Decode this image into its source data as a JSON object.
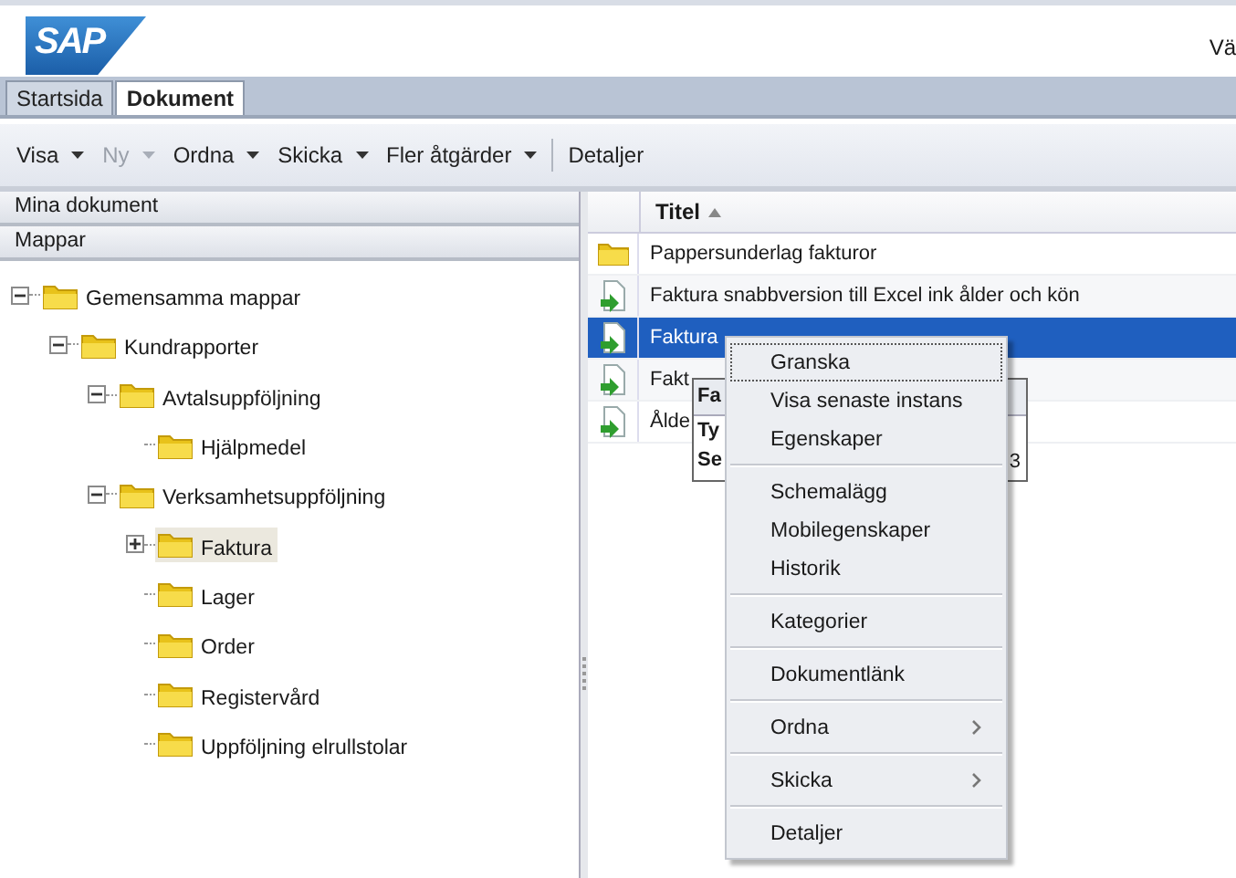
{
  "header": {
    "logo": "SAP",
    "user_text": "Vä"
  },
  "tabs": [
    {
      "label": "Startsida",
      "selected": false
    },
    {
      "label": "Dokument",
      "selected": true
    }
  ],
  "toolbar": [
    {
      "label": "Visa",
      "kind": "dropdown",
      "disabled": false
    },
    {
      "label": "Ny",
      "kind": "dropdown",
      "disabled": true
    },
    {
      "label": "Ordna",
      "kind": "dropdown",
      "disabled": false
    },
    {
      "label": "Skicka",
      "kind": "dropdown",
      "disabled": false
    },
    {
      "label": "Fler åtgärder",
      "kind": "dropdown",
      "disabled": false
    },
    {
      "label": "Detaljer",
      "kind": "button",
      "disabled": false
    }
  ],
  "sidebar": {
    "sections": [
      "Mina dokument",
      "Mappar"
    ],
    "tree": [
      {
        "label": "Gemensamma mappar",
        "kind": "branch",
        "expanded": true,
        "selected": false,
        "children": [
          {
            "label": "Kundrapporter",
            "kind": "branch",
            "expanded": true,
            "selected": false,
            "children": [
              {
                "label": "Avtalsuppföljning",
                "kind": "branch",
                "expanded": true,
                "selected": false,
                "children": [
                  {
                    "label": "Hjälpmedel",
                    "kind": "leaf",
                    "selected": false
                  }
                ]
              },
              {
                "label": "Verksamhetsuppföljning",
                "kind": "branch",
                "expanded": true,
                "selected": false,
                "children": [
                  {
                    "label": "Faktura",
                    "kind": "branch",
                    "expanded": false,
                    "selected": true
                  },
                  {
                    "label": "Lager",
                    "kind": "leaf",
                    "selected": false
                  },
                  {
                    "label": "Order",
                    "kind": "leaf",
                    "selected": false
                  },
                  {
                    "label": "Registervård",
                    "kind": "leaf",
                    "selected": false
                  },
                  {
                    "label": "Uppföljning elrullstolar",
                    "kind": "leaf",
                    "selected": false
                  }
                ]
              }
            ]
          }
        ]
      }
    ]
  },
  "table": {
    "columns": [
      {
        "label": "Titel"
      }
    ],
    "rows": [
      {
        "title": "Pappersunderlag fakturor",
        "kind": "folder",
        "selected": false
      },
      {
        "title": "Faktura snabbversion till Excel ink ålder och kön",
        "kind": "report",
        "selected": false
      },
      {
        "title": "Faktura",
        "kind": "report",
        "selected": true
      },
      {
        "title": "Fakt",
        "kind": "report",
        "selected": false
      },
      {
        "title": "Ålde",
        "kind": "report",
        "selected": false
      }
    ]
  },
  "tooltip": {
    "title": "Fa",
    "lines": [
      "Ty",
      "Se"
    ],
    "trailing": "3"
  },
  "context_menu": {
    "groups": [
      [
        {
          "label": "Granska",
          "submenu": false,
          "focused": true
        },
        {
          "label": "Visa senaste instans",
          "submenu": false,
          "focused": false
        },
        {
          "label": "Egenskaper",
          "submenu": false,
          "focused": false
        }
      ],
      [
        {
          "label": "Schemalägg",
          "submenu": false,
          "focused": false
        },
        {
          "label": "Mobilegenskaper",
          "submenu": false,
          "focused": false
        },
        {
          "label": "Historik",
          "submenu": false,
          "focused": false
        }
      ],
      [
        {
          "label": "Kategorier",
          "submenu": false,
          "focused": false
        }
      ],
      [
        {
          "label": "Dokumentlänk",
          "submenu": false,
          "focused": false
        }
      ],
      [
        {
          "label": "Ordna",
          "submenu": true,
          "focused": false
        }
      ],
      [
        {
          "label": "Skicka",
          "submenu": true,
          "focused": false
        }
      ],
      [
        {
          "label": "Detaljer",
          "submenu": false,
          "focused": false
        }
      ]
    ]
  }
}
